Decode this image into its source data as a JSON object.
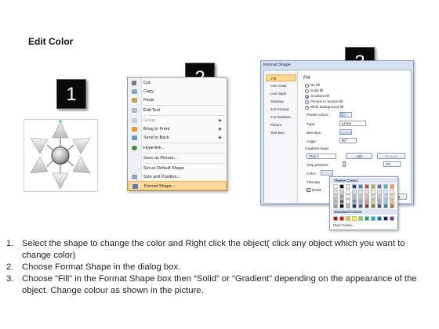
{
  "slide": {
    "title": "Edit Color"
  },
  "steps": [
    {
      "number": "1"
    },
    {
      "number": "2"
    },
    {
      "number": "3"
    }
  ],
  "context_menu": {
    "items": [
      {
        "label": "Cut",
        "icon": "scissors-icon",
        "disabled": false,
        "submenu": false
      },
      {
        "label": "Copy",
        "icon": "copy-icon",
        "disabled": false,
        "submenu": false
      },
      {
        "label": "Paste",
        "icon": "paste-icon",
        "disabled": false,
        "submenu": false
      },
      {
        "label": "Edit Text",
        "icon": "text-icon",
        "disabled": false,
        "submenu": false
      },
      {
        "label": "Group",
        "icon": "group-icon",
        "disabled": true,
        "submenu": true
      },
      {
        "label": "Bring to Front",
        "icon": "bring-front-icon",
        "disabled": false,
        "submenu": true
      },
      {
        "label": "Send to Back",
        "icon": "send-back-icon",
        "disabled": false,
        "submenu": true
      },
      {
        "label": "Hyperlink...",
        "icon": "globe-icon",
        "disabled": false,
        "submenu": false
      },
      {
        "label": "Save as Picture...",
        "icon": "",
        "disabled": false,
        "submenu": false
      },
      {
        "label": "Set as Default Shape",
        "icon": "",
        "disabled": false,
        "submenu": false
      },
      {
        "label": "Size and Position...",
        "icon": "size-icon",
        "disabled": false,
        "submenu": false
      },
      {
        "label": "Format Shape...",
        "icon": "format-icon",
        "disabled": false,
        "submenu": false,
        "highlighted": true
      }
    ]
  },
  "format_dialog": {
    "title": "Format Shape",
    "nav": [
      "Fill",
      "Line Color",
      "Line Style",
      "Shadow",
      "3-D Format",
      "3-D Rotation",
      "Picture",
      "Text Box"
    ],
    "active_nav": "Fill",
    "section_title": "Fill",
    "fill_options": [
      {
        "label": "No fill",
        "selected": false
      },
      {
        "label": "Solid fill",
        "selected": false
      },
      {
        "label": "Gradient fill",
        "selected": true
      },
      {
        "label": "Picture or texture fill",
        "selected": false
      },
      {
        "label": "Slide background fill",
        "selected": false
      }
    ],
    "preset_colors_label": "Preset colors:",
    "type_label": "Type:",
    "type_value": "Linear",
    "direction_label": "Direction:",
    "angle_label": "Angle:",
    "angle_value": "90°",
    "gradient_stops_label": "Gradient stops",
    "stop_value": "Stop 1",
    "add_label": "Add",
    "remove_label": "Remove",
    "stop_position_label": "Stop position:",
    "stop_position_value": "0%",
    "color_label": "Color:",
    "transparency_label": "Transpa",
    "rotate_label": "Rotat",
    "close_label": "se"
  },
  "palette": {
    "theme_label": "Theme Colors",
    "standard_label": "Standard Colors",
    "more_label": "More Colors...",
    "theme_top_row": [
      "#ffffff",
      "#000000",
      "#eeece1",
      "#1f497d",
      "#4f81bd",
      "#c0504d",
      "#9bbb59",
      "#8064a2",
      "#4bacc6",
      "#f79646"
    ],
    "standard_colors": [
      "#c00000",
      "#ff0000",
      "#ffc000",
      "#ffff00",
      "#92d050",
      "#00b050",
      "#00b0f0",
      "#0070c0",
      "#002060",
      "#7030a0"
    ]
  },
  "instructions": [
    {
      "num": "1.",
      "text": "Select the shape to change the color and Right click the object( click any object which you want to change color)"
    },
    {
      "num": "2.",
      "text": "Choose Format Shape in the dialog box."
    },
    {
      "num": "3.",
      "text": "Choose “Fill” in the Format Shape box then “Solid” or “Gradient” depending on the appearance of the object. Change colour as shown in the picture."
    }
  ]
}
